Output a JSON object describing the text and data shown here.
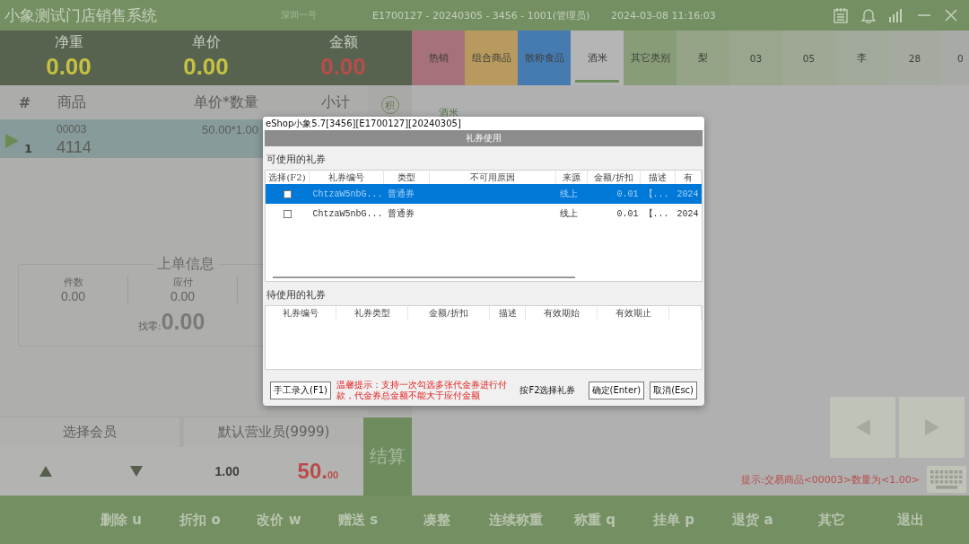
{
  "title_bar": {
    "title": "小象测试门店销售系统",
    "store": "深圳一号",
    "session": "E1700127 - 20240305 - 3456 - 1001(管理员)",
    "datetime": "2024-03-08 11:16:03"
  },
  "metrics": [
    {
      "label": "净重",
      "value": "0.00",
      "kind": "normal"
    },
    {
      "label": "单价",
      "value": "0.00",
      "kind": "normal"
    },
    {
      "label": "金额",
      "value": "0.00",
      "kind": "total"
    }
  ],
  "order_table": {
    "columns": [
      "#",
      "商品",
      "单价*数量",
      "小计"
    ],
    "rows": [
      {
        "index": "1",
        "code": "00003",
        "name": "4114",
        "price_qty": "50.00*1.00",
        "selected": true
      }
    ]
  },
  "points_button": "积",
  "last_order": {
    "title": "上单信息",
    "stats": [
      {
        "label": "件数",
        "value": "0.00"
      },
      {
        "label": "应付",
        "value": "0.00"
      }
    ],
    "change_label": "找零:",
    "change": "0.00"
  },
  "member_button": "选择会员",
  "salesperson_button": "默认营业员(9999)",
  "quantity": "1.00",
  "total": {
    "whole": "50.",
    "fraction": "00"
  },
  "checkout_button": "结算",
  "category_tabs": [
    {
      "label": "热销",
      "color": "#a6717a",
      "selected": false
    },
    {
      "label": "组合商品",
      "color": "#b99a5e",
      "selected": false
    },
    {
      "label": "散称食品",
      "color": "#467bb2",
      "selected": false
    },
    {
      "label": "酒米",
      "color": "#b5b5b5",
      "selected": true
    },
    {
      "label": "其它类别",
      "color": "#889c78",
      "selected": false
    },
    {
      "label": "梨",
      "color": "#95a386",
      "selected": false
    },
    {
      "label": "03",
      "color": "#9aa68e",
      "selected": false
    },
    {
      "label": "05",
      "color": "#9ea894",
      "selected": false
    },
    {
      "label": "李",
      "color": "#a1a99a",
      "selected": false
    },
    {
      "label": "28",
      "color": "#a5aaa0",
      "selected": false
    },
    {
      "label": "0",
      "color": "#a8aba5",
      "selected": false
    }
  ],
  "category_title": "酒米",
  "hint": "提示:交易商品<00003>数量为<1.00>",
  "function_keys": [
    "删除 u",
    "折扣 o",
    "改价 w",
    "赠送 s",
    "凑整",
    "连续称重",
    "称重 q",
    "挂单 p",
    "退货 a",
    "其它",
    "退出"
  ],
  "dialog": {
    "window_title": "eShop小象5.7[3456][E1700127][20240305]",
    "title": "礼券使用",
    "available": {
      "label": "可使用的礼券",
      "columns": [
        "选择(F2)",
        "礼券编号",
        "类型",
        "不可用原因",
        "来源",
        "金额/折扣",
        "描述",
        "有"
      ],
      "rows": [
        {
          "selected": true,
          "checked": false,
          "code": "ChtzaW5nbG...",
          "type": "普通券",
          "source": "线上",
          "amount": "0.01",
          "description": "【...",
          "valid": "2024"
        },
        {
          "selected": false,
          "checked": false,
          "code": "ChtzaW5nbG...",
          "type": "普通券",
          "source": "线上",
          "amount": "0.01",
          "description": "【...",
          "valid": "2024"
        }
      ]
    },
    "pending": {
      "label": "待使用的礼券",
      "columns": [
        "礼券编号",
        "礼券类型",
        "金额/折扣",
        "描述",
        "有效期始",
        "有效期止"
      ]
    },
    "manual_button": "手工录入(F1)",
    "tip": "温馨提示：支持一次勾选多张代金券进行付款，代金券总金额不能大于应付金额",
    "shortcut_hint": "按F2选择礼券",
    "confirm_button": "确定(Enter)",
    "cancel_button": "取消(Esc)"
  }
}
